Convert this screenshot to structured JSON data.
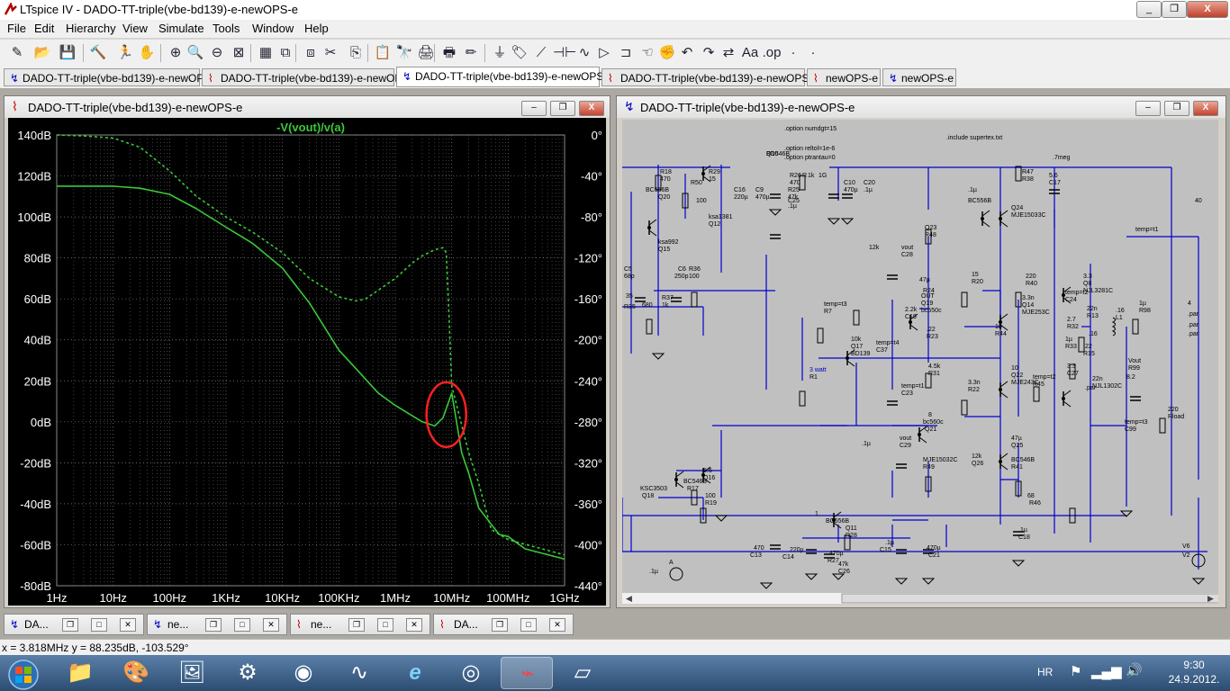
{
  "app": {
    "title": "LTspice IV - DADO-TT-triple(vbe-bd139)-e-newOPS-e",
    "window_buttons": [
      "_",
      "❐",
      "X"
    ]
  },
  "menu": [
    "File",
    "Edit",
    "Hierarchy",
    "View",
    "Simulate",
    "Tools",
    "Window",
    "Help"
  ],
  "toolbar_icons": [
    "open-schematic-icon",
    "open-file-icon",
    "save-icon",
    "control-panel-icon",
    "run-icon",
    "halt-icon",
    "zoom-in-icon",
    "zoom-pan-icon",
    "zoom-out-icon",
    "zoom-fit-icon",
    "autorange-icon",
    "tile-icon",
    "cascade-icon",
    "close-windows-icon",
    "cut-icon",
    "copy-icon",
    "paste-icon",
    "find-icon",
    "print-icon",
    "print-setup-icon",
    "draw-wire-icon",
    "ground-icon",
    "label-net-icon",
    "resistor-icon",
    "capacitor-icon",
    "inductor-icon",
    "diode-icon",
    "component-icon",
    "move-icon",
    "drag-icon",
    "undo-icon",
    "redo-icon",
    "rotate-icon",
    "mirror-icon",
    "text-icon",
    "spice-directive-icon"
  ],
  "toolbar_glyphs": [
    "✎",
    "📂",
    "💾",
    "🔨",
    "🏃",
    "✋",
    "⊕",
    "🔍",
    "⊖",
    "⊠",
    "▦",
    "⧉",
    "⧈",
    "✂",
    "⎘",
    "📋",
    "🔭",
    "🖨",
    "🖶",
    "✏",
    "⏚",
    "🏷",
    "⟋",
    "⊣⊢",
    "∿",
    "▷",
    "⊐",
    "☜",
    "✊",
    "↶",
    "↷",
    "⇄",
    "Aa",
    ".op"
  ],
  "tabs": [
    {
      "label": "DADO-TT-triple(vbe-bd139)-e-newOPS",
      "kind": "schematic"
    },
    {
      "label": "DADO-TT-triple(vbe-bd139)-e-newOPS",
      "kind": "plot"
    },
    {
      "label": "DADO-TT-triple(vbe-bd139)-e-newOPS-e",
      "kind": "schematic"
    },
    {
      "label": "DADO-TT-triple(vbe-bd139)-e-newOPS-e",
      "kind": "plot"
    },
    {
      "label": "newOPS-e",
      "kind": "plot"
    },
    {
      "label": "newOPS-e",
      "kind": "schematic"
    }
  ],
  "plot_window": {
    "title": "DADO-TT-triple(vbe-bd139)-e-newOPS-e",
    "trace_label": "-V(vout)/v(a)",
    "buttons": [
      "–",
      "❐",
      "X"
    ]
  },
  "chart_data": {
    "type": "line",
    "title": "",
    "trace": "-V(vout)/v(a)",
    "x_scale": "log",
    "x_ticks": [
      "1Hz",
      "10Hz",
      "100Hz",
      "1KHz",
      "10KHz",
      "100KHz",
      "1MHz",
      "10MHz",
      "100MHz",
      "1GHz"
    ],
    "xlim": [
      "1Hz",
      "1GHz"
    ],
    "y_left_ticks": [
      "140dB",
      "120dB",
      "100dB",
      "80dB",
      "60dB",
      "40dB",
      "20dB",
      "0dB",
      "-20dB",
      "-40dB",
      "-60dB",
      "-80dB"
    ],
    "ylim_left": [
      -80,
      140
    ],
    "y_right_ticks": [
      "0°",
      "-40°",
      "-80°",
      "-120°",
      "-160°",
      "-200°",
      "-240°",
      "-280°",
      "-320°",
      "-360°",
      "-400°",
      "-440°"
    ],
    "ylim_right": [
      -440,
      0
    ],
    "grid": true,
    "series": [
      {
        "name": "magnitude (dB)",
        "style": "solid",
        "axis": "left",
        "x": [
          1,
          3,
          10,
          30,
          100,
          300,
          1000,
          3000,
          10000,
          30000,
          100000,
          200000,
          500000,
          1000000,
          3000000,
          5000000,
          7000000,
          10000000,
          15000000,
          20000000,
          30000000,
          50000000,
          70000000,
          100000000,
          200000000,
          1000000000
        ],
        "y": [
          115,
          115,
          115,
          114,
          111,
          104,
          95,
          87,
          75,
          58,
          35,
          26,
          14,
          8,
          0,
          -2,
          2,
          14,
          -15,
          -25,
          -42,
          -50,
          -55,
          -56,
          -62,
          -67
        ]
      },
      {
        "name": "phase (°)",
        "style": "dashed",
        "axis": "right",
        "x": [
          1,
          3,
          10,
          30,
          100,
          300,
          1000,
          3000,
          10000,
          30000,
          100000,
          200000,
          300000,
          1000000,
          2000000,
          3000000,
          5000000,
          7000000,
          8000000,
          9000000,
          10000000,
          20000000,
          30000000,
          50000000,
          100000000,
          1000000000
        ],
        "y": [
          0,
          -1,
          -3,
          -12,
          -35,
          -60,
          -80,
          -95,
          -115,
          -140,
          -158,
          -162,
          -160,
          -140,
          -125,
          -118,
          -112,
          -110,
          -115,
          -180,
          -245,
          -310,
          -340,
          -385,
          -395,
          -410
        ]
      }
    ],
    "annotation": {
      "type": "red-ellipse",
      "around": "10MHz"
    }
  },
  "schematic_window": {
    "title": "DADO-TT-triple(vbe-bd139)-e-newOPS-e",
    "buttons": [
      "–",
      "❐",
      "X"
    ],
    "directives": [
      ".option numdgt=15",
      ".option reltol=1e-6",
      ".option ptrantau=0",
      ".include supertex.txt"
    ],
    "labels": [
      {
        "t": "BD546B"
      },
      {
        "t": "R18"
      },
      {
        "t": "470"
      },
      {
        "t": "BC556B"
      },
      {
        "t": "Q20"
      },
      {
        "t": "R29"
      },
      {
        "t": "15"
      },
      {
        "t": "R50"
      },
      {
        "t": "100"
      },
      {
        "t": "C16"
      },
      {
        "t": "220µ"
      },
      {
        "t": "C9"
      },
      {
        "t": "470µ"
      },
      {
        "t": "R25"
      },
      {
        "t": "47k"
      },
      {
        "t": "R26"
      },
      {
        "t": "470"
      },
      {
        "t": "C25"
      },
      {
        "t": ".1µ"
      },
      {
        "t": "R"
      },
      {
        "t": "1k"
      },
      {
        "t": "1G"
      },
      {
        "t": "C10"
      },
      {
        "t": "470µ"
      },
      {
        "t": "C20"
      },
      {
        "t": ".1µ"
      },
      {
        "t": "ksa1381"
      },
      {
        "t": "Q12"
      },
      {
        "t": "ksa992"
      },
      {
        "t": "Q15"
      },
      {
        "t": "C5"
      },
      {
        "t": "68p"
      },
      {
        "t": "C6"
      },
      {
        "t": "250p"
      },
      {
        "t": "R36"
      },
      {
        "t": "100"
      },
      {
        "t": "R35"
      },
      {
        "t": "R37"
      },
      {
        "t": "1k"
      },
      {
        "t": "680"
      },
      {
        "t": "35"
      },
      {
        "t": ".7meg"
      },
      {
        "t": "R47"
      },
      {
        "t": "R38"
      },
      {
        "t": "5.6"
      },
      {
        "t": "C17"
      },
      {
        "t": ".1µ"
      },
      {
        "t": "BC556B"
      },
      {
        "t": "Q24"
      },
      {
        "t": "MJE15033C"
      },
      {
        "t": "Q23"
      },
      {
        "t": "R48"
      },
      {
        "t": "12k"
      },
      {
        "t": "vout"
      },
      {
        "t": "C28"
      },
      {
        "t": "47µ"
      },
      {
        "t": "R24"
      },
      {
        "t": "15"
      },
      {
        "t": "R20"
      },
      {
        "t": "220"
      },
      {
        "t": "R40"
      },
      {
        "t": "3.3"
      },
      {
        "t": "Q8"
      },
      {
        "t": "NJL3281C"
      },
      {
        "t": "temp=t1"
      },
      {
        "t": "OUT"
      },
      {
        "t": "Q19"
      },
      {
        "t": "bc550c"
      },
      {
        "t": "temp=t3"
      },
      {
        "t": "R7"
      },
      {
        "t": "2.2k"
      },
      {
        "t": "C19"
      },
      {
        "t": "3.3n"
      },
      {
        "t": "Q14"
      },
      {
        "t": "MJE253C"
      },
      {
        "t": "temp=t2"
      },
      {
        "t": "C24"
      },
      {
        "t": "22n"
      },
      {
        "t": "R13"
      },
      {
        "t": ".16"
      },
      {
        "t": "L1"
      },
      {
        "t": "1µ"
      },
      {
        "t": "R98"
      },
      {
        "t": "2.7"
      },
      {
        "t": "R32"
      },
      {
        "t": ".22"
      },
      {
        "t": "R23"
      },
      {
        "t": "10"
      },
      {
        "t": "R44"
      },
      {
        "t": "10k"
      },
      {
        "t": "Q17"
      },
      {
        "t": "BD139"
      },
      {
        "t": "temp=t4"
      },
      {
        "t": "C37"
      },
      {
        "t": "1µ"
      },
      {
        "t": "R33"
      },
      {
        "t": ".22"
      },
      {
        "t": "R15"
      },
      {
        "t": ".16"
      },
      {
        "t": "Vout"
      },
      {
        "t": "R99"
      },
      {
        "t": "8.2"
      },
      {
        "t": "3 watt"
      },
      {
        "t": "R1"
      },
      {
        "t": "4.5k"
      },
      {
        "t": "R31"
      },
      {
        "t": "10"
      },
      {
        "t": "Q22"
      },
      {
        "t": "MJE243C"
      },
      {
        "t": "temp=t2"
      },
      {
        "t": "R45"
      },
      {
        "t": "3.3"
      },
      {
        "t": "C27"
      },
      {
        "t": "22n"
      },
      {
        "t": "NJL1302C"
      },
      {
        "t": "temp=t1"
      },
      {
        "t": "C23"
      },
      {
        "t": "3.3n"
      },
      {
        "t": "R22"
      },
      {
        "t": "220"
      },
      {
        "t": "Rload"
      },
      {
        "t": "8"
      },
      {
        "t": "bc560c"
      },
      {
        "t": "Q21"
      },
      {
        "t": "temp=t3"
      },
      {
        "t": "C99"
      },
      {
        "t": ".1µ"
      },
      {
        "t": "vout"
      },
      {
        "t": "C29"
      },
      {
        "t": "47µ"
      },
      {
        "t": "Q25"
      },
      {
        "t": "MJE15032C"
      },
      {
        "t": "R49"
      },
      {
        "t": "12k"
      },
      {
        "t": "Q26"
      },
      {
        "t": "BC546B"
      },
      {
        "t": "R41"
      },
      {
        "t": "5.6"
      },
      {
        "t": "Q16"
      },
      {
        "t": "KSC3503"
      },
      {
        "t": "Q18"
      },
      {
        "t": "BC546B"
      },
      {
        "t": "R17"
      },
      {
        "t": "100"
      },
      {
        "t": "R19"
      },
      {
        "t": "68"
      },
      {
        "t": "R46"
      },
      {
        "t": "1"
      },
      {
        "t": "BC556B"
      },
      {
        "t": "Q11"
      },
      {
        "t": "R28"
      },
      {
        "t": "470"
      },
      {
        "t": "C13"
      },
      {
        "t": "220µ"
      },
      {
        "t": "C14"
      },
      {
        "t": "470µ"
      },
      {
        "t": "R27"
      },
      {
        "t": "47k"
      },
      {
        "t": "C26"
      },
      {
        "t": ".1µ"
      },
      {
        "t": "C15"
      },
      {
        "t": "470µ"
      },
      {
        "t": "C21"
      },
      {
        "t": ".1µ"
      },
      {
        "t": "C18"
      },
      {
        "t": ".1µ"
      },
      {
        "t": "A"
      },
      {
        "t": "V6"
      },
      {
        "t": "V2"
      },
      {
        "t": "40"
      },
      {
        "t": "4"
      },
      {
        "t": ".par"
      },
      {
        "t": ".par"
      },
      {
        "t": ".par"
      },
      {
        "t": ".par"
      },
      {
        "t": "Q10"
      }
    ]
  },
  "minimized_windows": [
    {
      "label": "DA...",
      "kind": "schematic"
    },
    {
      "label": "ne...",
      "kind": "schematic"
    },
    {
      "label": "ne...",
      "kind": "plot"
    },
    {
      "label": "DA...",
      "kind": "plot"
    }
  ],
  "status": {
    "text": "x = 3.818MHz   y = 88.235dB, -103.529°"
  },
  "taskbar": {
    "apps": [
      "explorer",
      "paint",
      "mspaint",
      "valve",
      "recorder",
      "oscilloscope",
      "internet-explorer",
      "media-player",
      "ltspice",
      "sticky-notes"
    ],
    "glyphs": [
      "📁",
      "🎨",
      "🖼",
      "⚙",
      "◉",
      "∿",
      "e",
      "◎",
      "⌁",
      "▱"
    ],
    "active_index": 8,
    "language": "HR",
    "time": "9:30",
    "date": "24.9.2012."
  },
  "colors": {
    "plot_bg": "#000000",
    "trace": "#3ac83a",
    "schematic_bg": "#c0c0c0",
    "wire": "#0000d0",
    "annotation": "#ff2020"
  }
}
